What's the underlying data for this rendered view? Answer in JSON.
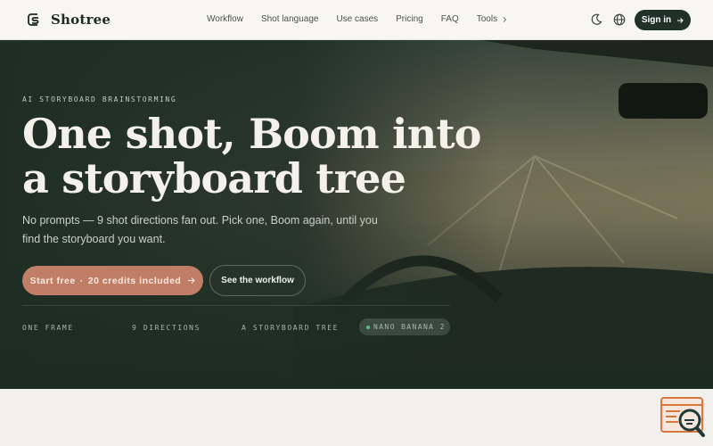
{
  "brand": {
    "name": "Shotree"
  },
  "nav": {
    "links": [
      "Workflow",
      "Shot language",
      "Use cases",
      "Pricing",
      "FAQ"
    ],
    "tools_label": "Tools",
    "signin_label": "Sign in"
  },
  "icons": {
    "theme": "moon-icon",
    "language": "globe-icon",
    "signin_arrow": "arrow-right-icon",
    "chat": "chat-search-icon"
  },
  "hero": {
    "eyebrow": "AI STORYBOARD BRAINSTORMING",
    "headline": "One shot, Boom into a storyboard tree",
    "subtitle": "No prompts — 9 shot directions fan out. Pick one, Boom again, until you find the storyboard you want.",
    "primary_cta": {
      "main": "Start free",
      "sep": "·",
      "extra": "20 credits included"
    },
    "secondary_cta": "See the workflow",
    "stats": [
      "ONE FRAME",
      "9 DIRECTIONS",
      "A STORYBOARD TREE"
    ],
    "model_badge": "NANO BANANA 2"
  },
  "colors": {
    "accent": "#c07e67",
    "dark": "#22302a",
    "hero_bg": "#233127",
    "status_dot": "#5fbf8a"
  }
}
